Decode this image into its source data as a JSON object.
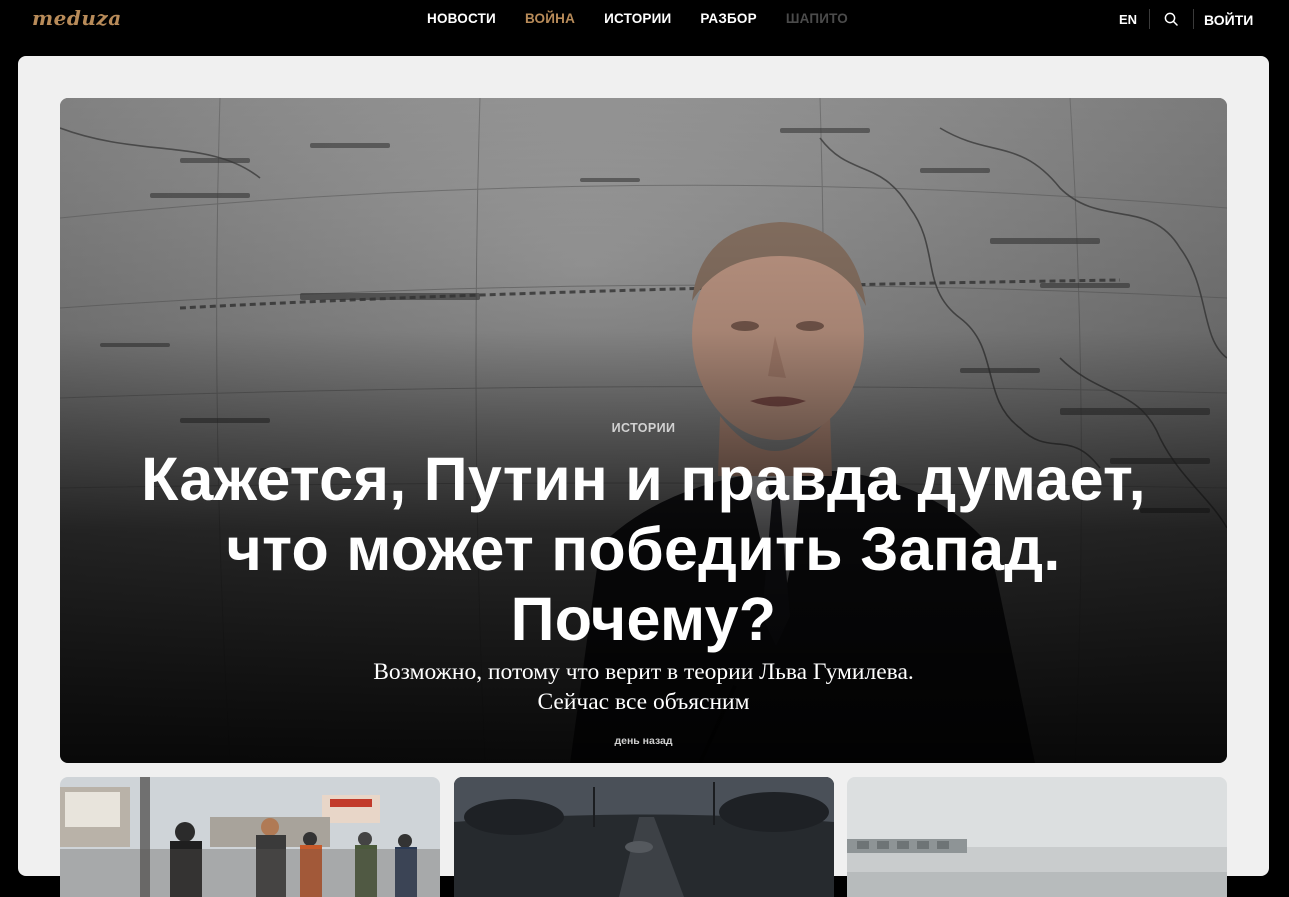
{
  "header": {
    "logo": "meduza",
    "nav": [
      {
        "label": "НОВОСТИ",
        "state": "normal"
      },
      {
        "label": "ВОЙНА",
        "state": "active"
      },
      {
        "label": "ИСТОРИИ",
        "state": "normal"
      },
      {
        "label": "РАЗБОР",
        "state": "normal"
      },
      {
        "label": "ШАПИТО",
        "state": "muted"
      }
    ],
    "lang": "EN",
    "search_icon": "search-icon",
    "login": "ВОЙТИ"
  },
  "hero": {
    "tag": "ИСТОРИИ",
    "title": "Кажется, Путин и правда думает, что может победить Запад. Почему?",
    "subtitle_line1": "Возможно, потому что верит в теории Льва Гумилева.",
    "subtitle_line2": "Сейчас все объясним",
    "time": "день назад"
  },
  "colors": {
    "brand": "#b88b59",
    "panel_bg": "#f0f0f0",
    "page_bg": "#000000",
    "muted_nav": "#4b4b4b"
  }
}
